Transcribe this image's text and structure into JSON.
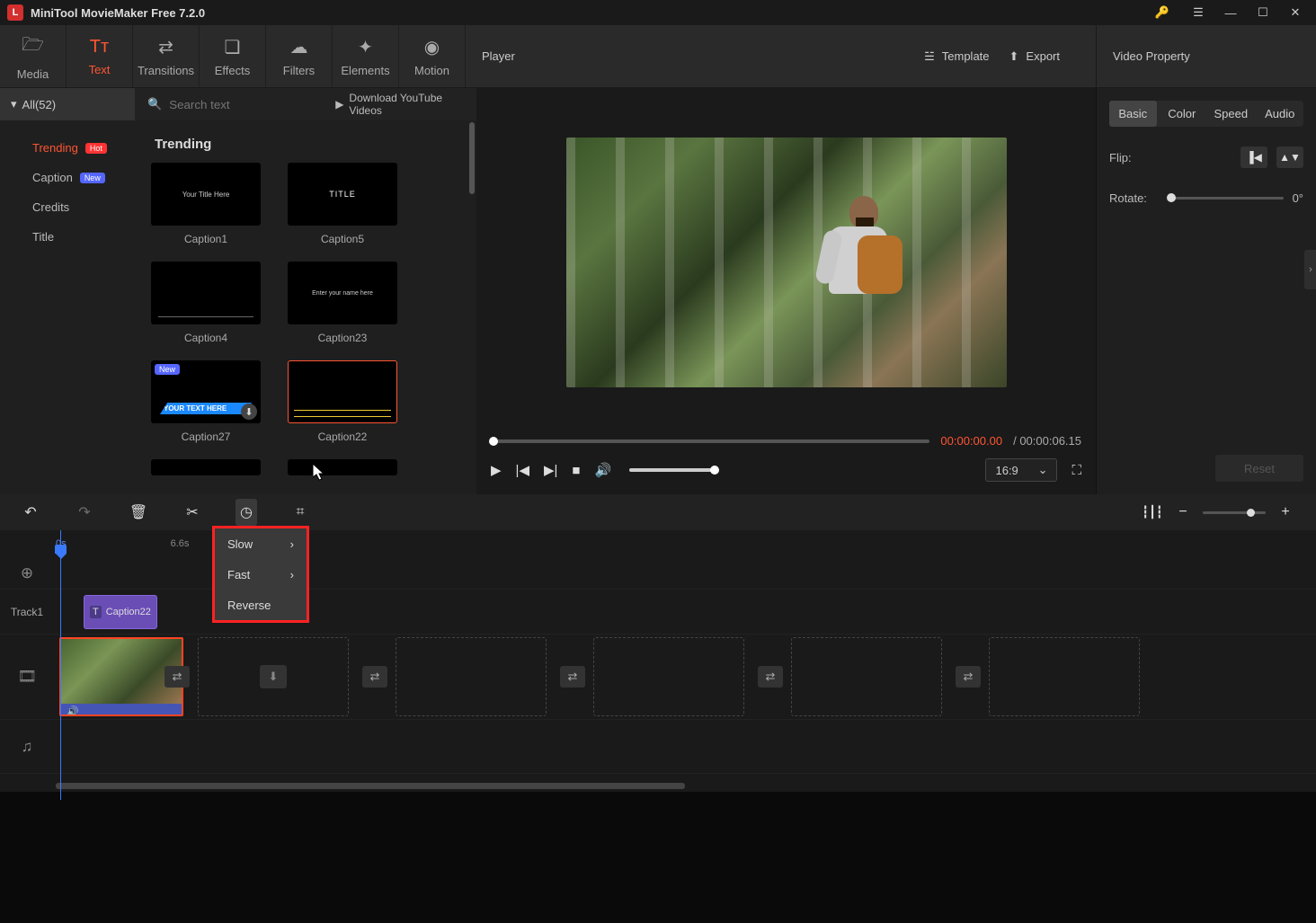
{
  "app": {
    "title": "MiniTool MovieMaker Free 7.2.0"
  },
  "toolbar": {
    "media": "Media",
    "text": "Text",
    "transitions": "Transitions",
    "effects": "Effects",
    "filters": "Filters",
    "elements": "Elements",
    "motion": "Motion"
  },
  "player_header": {
    "label": "Player",
    "template": "Template",
    "export": "Export"
  },
  "props_header": {
    "label": "Video Property"
  },
  "sidebar": {
    "all": "All(52)",
    "cats": [
      {
        "label": "Trending",
        "badge": "Hot"
      },
      {
        "label": "Caption",
        "badge": "New"
      },
      {
        "label": "Credits",
        "badge": ""
      },
      {
        "label": "Title",
        "badge": ""
      }
    ]
  },
  "browser": {
    "search_ph": "Search text",
    "dl": "Download YouTube Videos",
    "heading": "Trending",
    "items": [
      {
        "label": "Caption1"
      },
      {
        "label": "Caption5"
      },
      {
        "label": "Caption4"
      },
      {
        "label": "Caption23"
      },
      {
        "label": "Caption27"
      },
      {
        "label": "Caption22"
      }
    ],
    "thumb_text": {
      "title": "TITLE",
      "yourtitle": "Your Title Here",
      "entername": "Enter your name here",
      "yourtext": "YOUR TEXT HERE",
      "new": "New"
    }
  },
  "player": {
    "cur": "00:00:00.00",
    "tot": "/ 00:00:06.15",
    "ar": "16:9"
  },
  "props": {
    "tabs": [
      "Basic",
      "Color",
      "Speed",
      "Audio"
    ],
    "flip": "Flip:",
    "rotate": "Rotate:",
    "rotval": "0°",
    "reset": "Reset"
  },
  "timeline": {
    "ruler": [
      "0s",
      "6.6s"
    ],
    "track1": "Track1",
    "txtclip": "Caption22",
    "speed_menu": [
      "Slow",
      "Fast",
      "Reverse"
    ]
  }
}
